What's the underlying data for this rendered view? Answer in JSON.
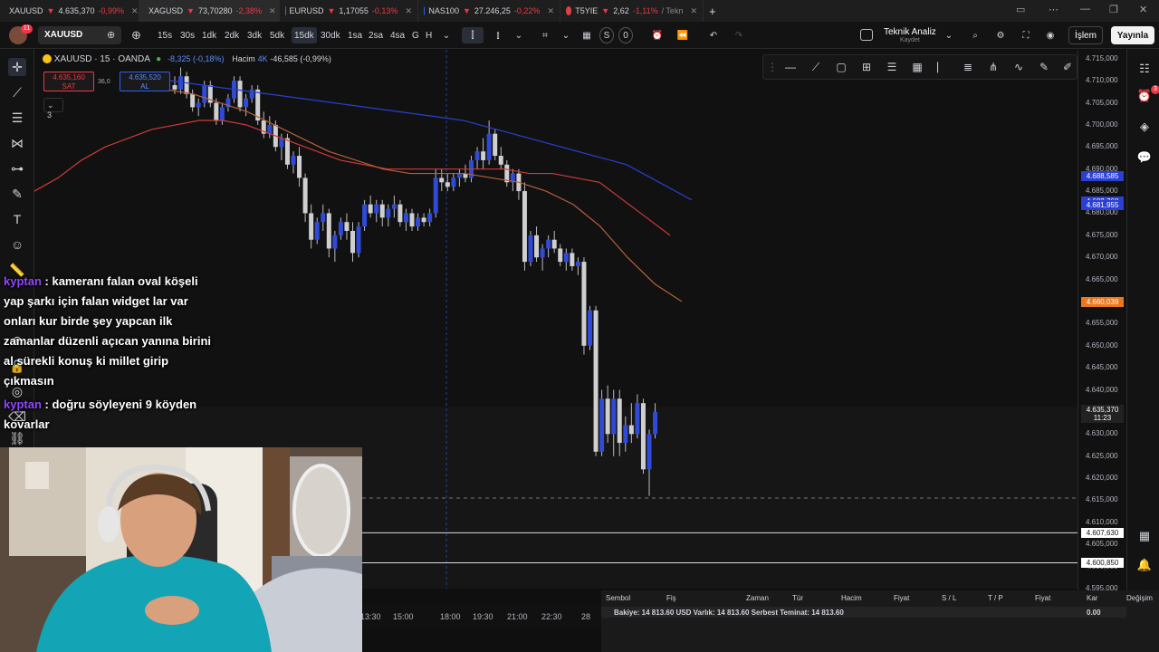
{
  "tabs": [
    {
      "symbol": "XAUUSD",
      "price": "4.635,370",
      "change": "-0,99%",
      "color": "#f5c518",
      "active": false
    },
    {
      "symbol": "XAGUSD",
      "price": "73,70280",
      "change": "-2,38%",
      "color": "#bbbbbb",
      "active": true
    },
    {
      "symbol": "EURUSD",
      "price": "1,17055",
      "change": "-0,13%",
      "color": "#3c6fd8",
      "active": false
    },
    {
      "symbol": "NAS100",
      "price": "27.246,25",
      "change": "-0,22%",
      "color": "#2962ff",
      "active": false
    },
    {
      "symbol": "T5YIE",
      "price": "2,62",
      "change": "-1,11%",
      "suffix": "/ Tekn",
      "color": "#e04040",
      "active": false
    }
  ],
  "toolbar": {
    "symbol": "XAUUSD",
    "intervals": [
      "15s",
      "30s",
      "1dk",
      "2dk",
      "3dk",
      "5dk",
      "15dk",
      "30dk",
      "1sa",
      "2sa",
      "4sa",
      "G",
      "H"
    ],
    "selected_interval": "15dk",
    "layout_name": "Teknik Analiz",
    "layout_status": "Kaydet",
    "s_label": "S",
    "o_label": "0",
    "trade_button": "İşlem",
    "publish_button": "Yayınla",
    "notif_count": "11"
  },
  "legend": {
    "title": "XAUUSD · 15 · OANDA",
    "change": "-8,325 (-0,18%)",
    "volume_label": "Hacim",
    "volume_value": "4K",
    "volume_change": "-46,585 (-0,99%)",
    "sell_price": "4.635,160",
    "sell_label": "SAT",
    "spread": "36,0",
    "buy_price": "4.635,520",
    "buy_label": "AL",
    "collapse_count": "3"
  },
  "price_scale": {
    "labels": [
      "4.715,000",
      "4.710,000",
      "4.705,000",
      "4.700,000",
      "4.695,000",
      "4.690,000",
      "4.685,000",
      "4.680,000",
      "4.675,000",
      "4.670,000",
      "4.665,000",
      "4.660,000",
      "4.655,000",
      "4.650,000",
      "4.645,000",
      "4.640,000",
      "4.635,000",
      "4.630,000",
      "4.625,000",
      "4.620,000",
      "4.615,000",
      "4.610,000",
      "4.605,000",
      "4.600,000",
      "4.595,000"
    ],
    "tags": [
      {
        "text": "4.688,585",
        "color": "#2b3fd4"
      },
      {
        "text": "4.682,760",
        "color": "#2b3fd4"
      },
      {
        "text": "4.681,955",
        "color": "#2b3fd4"
      },
      {
        "text": "4.660,039",
        "color": "#e8771e"
      },
      {
        "text": "4.607,630",
        "color": "#ffffff"
      },
      {
        "text": "4.600,850",
        "color": "#ffffff"
      }
    ],
    "current_price": "4.635,370",
    "countdown": "11:23"
  },
  "time_axis": [
    "13:30",
    "15:00",
    "18:00",
    "19:30",
    "21:00",
    "22:30",
    "28"
  ],
  "chart_data": {
    "type": "candlestick",
    "ylim": [
      4595,
      4717
    ],
    "candles": [
      [
        4709,
        4711,
        4707,
        4708
      ],
      [
        4708,
        4713,
        4707,
        4711
      ],
      [
        4711,
        4712,
        4706,
        4707
      ],
      [
        4707,
        4708,
        4703,
        4704
      ],
      [
        4704,
        4706,
        4702,
        4705
      ],
      [
        4705,
        4710,
        4704,
        4709
      ],
      [
        4709,
        4710,
        4704,
        4705
      ],
      [
        4705,
        4706,
        4700,
        4701
      ],
      [
        4701,
        4705,
        4700,
        4704
      ],
      [
        4704,
        4707,
        4703,
        4706
      ],
      [
        4706,
        4711,
        4705,
        4710
      ],
      [
        4710,
        4711,
        4703,
        4704
      ],
      [
        4704,
        4707,
        4702,
        4706
      ],
      [
        4706,
        4709,
        4705,
        4708
      ],
      [
        4708,
        4709,
        4700,
        4701
      ],
      [
        4701,
        4703,
        4697,
        4698
      ],
      [
        4698,
        4702,
        4697,
        4700
      ],
      [
        4700,
        4701,
        4694,
        4695
      ],
      [
        4695,
        4698,
        4692,
        4697
      ],
      [
        4697,
        4698,
        4690,
        4691
      ],
      [
        4691,
        4694,
        4689,
        4693
      ],
      [
        4693,
        4695,
        4686,
        4688
      ],
      [
        4688,
        4689,
        4678,
        4680
      ],
      [
        4680,
        4682,
        4672,
        4674
      ],
      [
        4674,
        4679,
        4673,
        4678
      ],
      [
        4678,
        4682,
        4676,
        4680
      ],
      [
        4680,
        4681,
        4670,
        4672
      ],
      [
        4672,
        4676,
        4669,
        4675
      ],
      [
        4675,
        4679,
        4674,
        4678
      ],
      [
        4678,
        4680,
        4674,
        4676
      ],
      [
        4676,
        4678,
        4669,
        4671
      ],
      [
        4671,
        4678,
        4670,
        4677
      ],
      [
        4677,
        4683,
        4676,
        4682
      ],
      [
        4682,
        4684,
        4679,
        4680
      ],
      [
        4680,
        4683,
        4678,
        4682
      ],
      [
        4682,
        4683,
        4677,
        4679
      ],
      [
        4679,
        4682,
        4677,
        4681
      ],
      [
        4681,
        4684,
        4679,
        4682
      ],
      [
        4682,
        4683,
        4677,
        4678
      ],
      [
        4678,
        4681,
        4676,
        4680
      ],
      [
        4680,
        4681,
        4676,
        4677
      ],
      [
        4677,
        4680,
        4676,
        4679
      ],
      [
        4679,
        4680,
        4677,
        4678
      ],
      [
        4678,
        4681,
        4677,
        4680
      ],
      [
        4680,
        4690,
        4679,
        4688
      ],
      [
        4688,
        4690,
        4685,
        4687
      ],
      [
        4687,
        4689,
        4685,
        4686
      ],
      [
        4686,
        4689,
        4685,
        4688
      ],
      [
        4688,
        4690,
        4686,
        4689
      ],
      [
        4689,
        4691,
        4687,
        4688
      ],
      [
        4688,
        4693,
        4687,
        4692
      ],
      [
        4692,
        4695,
        4690,
        4694
      ],
      [
        4694,
        4697,
        4690,
        4692
      ],
      [
        4692,
        4701,
        4691,
        4698
      ],
      [
        4698,
        4699,
        4692,
        4693
      ],
      [
        4693,
        4695,
        4690,
        4691
      ],
      [
        4691,
        4692,
        4686,
        4687
      ],
      [
        4687,
        4690,
        4685,
        4689
      ],
      [
        4689,
        4690,
        4683,
        4685
      ],
      [
        4685,
        4687,
        4667,
        4669
      ],
      [
        4669,
        4676,
        4668,
        4675
      ],
      [
        4675,
        4677,
        4669,
        4670
      ],
      [
        4670,
        4673,
        4667,
        4672
      ],
      [
        4672,
        4675,
        4670,
        4674
      ],
      [
        4674,
        4676,
        4671,
        4672
      ],
      [
        4672,
        4673,
        4668,
        4669
      ],
      [
        4669,
        4672,
        4667,
        4671
      ],
      [
        4671,
        4672,
        4667,
        4668
      ],
      [
        4668,
        4670,
        4666,
        4669
      ],
      [
        4669,
        4670,
        4648,
        4650
      ],
      [
        4650,
        4659,
        4649,
        4658
      ],
      [
        4658,
        4659,
        4625,
        4626
      ],
      [
        4626,
        4640,
        4625,
        4638
      ],
      [
        4638,
        4641,
        4628,
        4630
      ],
      [
        4630,
        4640,
        4625,
        4638
      ],
      [
        4638,
        4640,
        4625,
        4628
      ],
      [
        4628,
        4634,
        4626,
        4632
      ],
      [
        4632,
        4637,
        4628,
        4630
      ],
      [
        4630,
        4639,
        4629,
        4637
      ],
      [
        4637,
        4638,
        4621,
        4622
      ],
      [
        4622,
        4631,
        4616,
        4630
      ],
      [
        4630,
        4637,
        4629,
        4635
      ]
    ],
    "ma_red": [
      4685,
      4688,
      4692,
      4695,
      4697,
      4699,
      4700,
      4701,
      4701,
      4700,
      4698,
      4696,
      4694,
      4692,
      4691,
      4690,
      4690,
      4690,
      4690,
      4690,
      4690,
      4689,
      4689,
      4688,
      4687,
      4683,
      4679,
      4675
    ],
    "ma_orange": [
      4708,
      4707,
      4705,
      4703,
      4700,
      4697,
      4694,
      4692,
      4690,
      4689,
      4689,
      4689,
      4688,
      4687,
      4685,
      4682,
      4677,
      4670,
      4664,
      4660
    ],
    "ma_blue": [
      4710,
      4709,
      4708,
      4707,
      4706,
      4705,
      4704,
      4703,
      4702,
      4701,
      4699,
      4697,
      4695,
      4693,
      4691,
      4687,
      4683
    ],
    "hlines": [
      4607.63,
      4600.85
    ],
    "dashed_price": 4615.5
  },
  "chat": [
    {
      "user": "kyptan",
      "text": "kameranı falan oval köşeli yap şarkı için falan widget lar var onları kur birde şey yapcan ilk zamanlar düzenli açıcan yanına birini al sürekli konuş ki millet girip çıkmasın"
    },
    {
      "user": "kyptan",
      "text": "doğru söyleyeni 9 köyden kovarlar"
    }
  ],
  "order_panel": {
    "headers": [
      "Sembol",
      "Fiş",
      "Zaman",
      "Tür",
      "Hacim",
      "Fiyat",
      "S / L",
      "T / P",
      "Fiyat",
      "Kar",
      "Değişim"
    ],
    "balance_row": "Bakiye: 14 813.60 USD  Varlık: 14 813.60  Serbest Teminat: 14 813.60",
    "balance_profit": "0.00"
  },
  "icons": {
    "left": [
      "crosshair-icon",
      "trend-line-icon",
      "fib-icon",
      "pattern-icon",
      "measure-icon",
      "brush-icon",
      "text-icon",
      "emoji-icon"
    ],
    "right": [
      "watchlist-icon",
      "alerts-icon",
      "layers-icon",
      "chat-icon",
      "calendar-icon",
      "notification-icon",
      "ideas-icon"
    ]
  }
}
